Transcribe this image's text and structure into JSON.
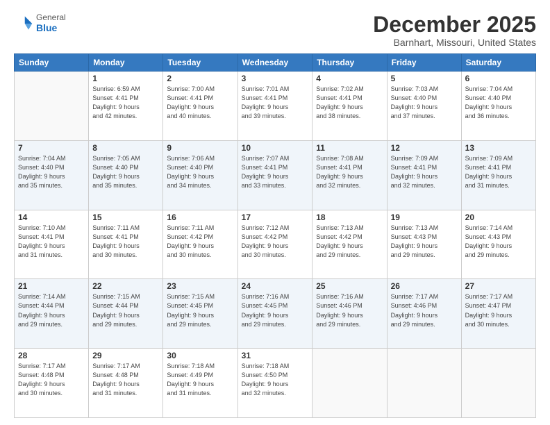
{
  "header": {
    "logo": {
      "general": "General",
      "blue": "Blue"
    },
    "title": "December 2025",
    "location": "Barnhart, Missouri, United States"
  },
  "days_of_week": [
    "Sunday",
    "Monday",
    "Tuesday",
    "Wednesday",
    "Thursday",
    "Friday",
    "Saturday"
  ],
  "weeks": [
    {
      "shade": "white",
      "days": [
        {
          "number": "",
          "info": ""
        },
        {
          "number": "1",
          "info": "Sunrise: 6:59 AM\nSunset: 4:41 PM\nDaylight: 9 hours\nand 42 minutes."
        },
        {
          "number": "2",
          "info": "Sunrise: 7:00 AM\nSunset: 4:41 PM\nDaylight: 9 hours\nand 40 minutes."
        },
        {
          "number": "3",
          "info": "Sunrise: 7:01 AM\nSunset: 4:41 PM\nDaylight: 9 hours\nand 39 minutes."
        },
        {
          "number": "4",
          "info": "Sunrise: 7:02 AM\nSunset: 4:41 PM\nDaylight: 9 hours\nand 38 minutes."
        },
        {
          "number": "5",
          "info": "Sunrise: 7:03 AM\nSunset: 4:40 PM\nDaylight: 9 hours\nand 37 minutes."
        },
        {
          "number": "6",
          "info": "Sunrise: 7:04 AM\nSunset: 4:40 PM\nDaylight: 9 hours\nand 36 minutes."
        }
      ]
    },
    {
      "shade": "shade",
      "days": [
        {
          "number": "7",
          "info": "Sunrise: 7:04 AM\nSunset: 4:40 PM\nDaylight: 9 hours\nand 35 minutes."
        },
        {
          "number": "8",
          "info": "Sunrise: 7:05 AM\nSunset: 4:40 PM\nDaylight: 9 hours\nand 35 minutes."
        },
        {
          "number": "9",
          "info": "Sunrise: 7:06 AM\nSunset: 4:40 PM\nDaylight: 9 hours\nand 34 minutes."
        },
        {
          "number": "10",
          "info": "Sunrise: 7:07 AM\nSunset: 4:41 PM\nDaylight: 9 hours\nand 33 minutes."
        },
        {
          "number": "11",
          "info": "Sunrise: 7:08 AM\nSunset: 4:41 PM\nDaylight: 9 hours\nand 32 minutes."
        },
        {
          "number": "12",
          "info": "Sunrise: 7:09 AM\nSunset: 4:41 PM\nDaylight: 9 hours\nand 32 minutes."
        },
        {
          "number": "13",
          "info": "Sunrise: 7:09 AM\nSunset: 4:41 PM\nDaylight: 9 hours\nand 31 minutes."
        }
      ]
    },
    {
      "shade": "white",
      "days": [
        {
          "number": "14",
          "info": "Sunrise: 7:10 AM\nSunset: 4:41 PM\nDaylight: 9 hours\nand 31 minutes."
        },
        {
          "number": "15",
          "info": "Sunrise: 7:11 AM\nSunset: 4:41 PM\nDaylight: 9 hours\nand 30 minutes."
        },
        {
          "number": "16",
          "info": "Sunrise: 7:11 AM\nSunset: 4:42 PM\nDaylight: 9 hours\nand 30 minutes."
        },
        {
          "number": "17",
          "info": "Sunrise: 7:12 AM\nSunset: 4:42 PM\nDaylight: 9 hours\nand 30 minutes."
        },
        {
          "number": "18",
          "info": "Sunrise: 7:13 AM\nSunset: 4:42 PM\nDaylight: 9 hours\nand 29 minutes."
        },
        {
          "number": "19",
          "info": "Sunrise: 7:13 AM\nSunset: 4:43 PM\nDaylight: 9 hours\nand 29 minutes."
        },
        {
          "number": "20",
          "info": "Sunrise: 7:14 AM\nSunset: 4:43 PM\nDaylight: 9 hours\nand 29 minutes."
        }
      ]
    },
    {
      "shade": "shade",
      "days": [
        {
          "number": "21",
          "info": "Sunrise: 7:14 AM\nSunset: 4:44 PM\nDaylight: 9 hours\nand 29 minutes."
        },
        {
          "number": "22",
          "info": "Sunrise: 7:15 AM\nSunset: 4:44 PM\nDaylight: 9 hours\nand 29 minutes."
        },
        {
          "number": "23",
          "info": "Sunrise: 7:15 AM\nSunset: 4:45 PM\nDaylight: 9 hours\nand 29 minutes."
        },
        {
          "number": "24",
          "info": "Sunrise: 7:16 AM\nSunset: 4:45 PM\nDaylight: 9 hours\nand 29 minutes."
        },
        {
          "number": "25",
          "info": "Sunrise: 7:16 AM\nSunset: 4:46 PM\nDaylight: 9 hours\nand 29 minutes."
        },
        {
          "number": "26",
          "info": "Sunrise: 7:17 AM\nSunset: 4:46 PM\nDaylight: 9 hours\nand 29 minutes."
        },
        {
          "number": "27",
          "info": "Sunrise: 7:17 AM\nSunset: 4:47 PM\nDaylight: 9 hours\nand 30 minutes."
        }
      ]
    },
    {
      "shade": "white",
      "days": [
        {
          "number": "28",
          "info": "Sunrise: 7:17 AM\nSunset: 4:48 PM\nDaylight: 9 hours\nand 30 minutes."
        },
        {
          "number": "29",
          "info": "Sunrise: 7:17 AM\nSunset: 4:48 PM\nDaylight: 9 hours\nand 31 minutes."
        },
        {
          "number": "30",
          "info": "Sunrise: 7:18 AM\nSunset: 4:49 PM\nDaylight: 9 hours\nand 31 minutes."
        },
        {
          "number": "31",
          "info": "Sunrise: 7:18 AM\nSunset: 4:50 PM\nDaylight: 9 hours\nand 32 minutes."
        },
        {
          "number": "",
          "info": ""
        },
        {
          "number": "",
          "info": ""
        },
        {
          "number": "",
          "info": ""
        }
      ]
    }
  ]
}
